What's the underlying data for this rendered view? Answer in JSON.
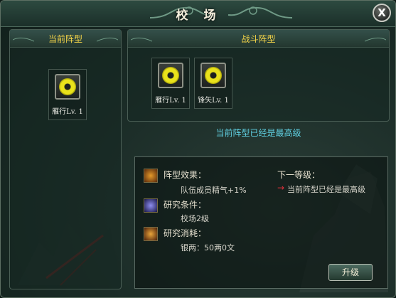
{
  "window": {
    "title": "校 场",
    "close_label": "X"
  },
  "left_panel": {
    "title": "当前阵型",
    "formation": {
      "name": "雁行",
      "level": "Lv. 1"
    }
  },
  "right_panel": {
    "title": "战斗阵型",
    "formations": [
      {
        "name": "雁行",
        "level": "Lv. 1"
      },
      {
        "name": "锋矢",
        "level": "Lv. 1"
      }
    ],
    "notice": "当前阵型已经是最高级"
  },
  "info": {
    "effect_label": "阵型效果：",
    "effect_value": "队伍成员精气+1%",
    "requirement_label": "研究条件：",
    "requirement_value": "校场2级",
    "cost_label": "研究消耗：",
    "cost_value": "银两：50两0文",
    "next_level_label": "下一等级：",
    "next_level_value": "当前阵型已经是最高级"
  },
  "upgrade_button": "升级",
  "colors": {
    "panel_title": "#f5d548",
    "notice": "#60d1e3",
    "arrow": "#e0303a"
  }
}
